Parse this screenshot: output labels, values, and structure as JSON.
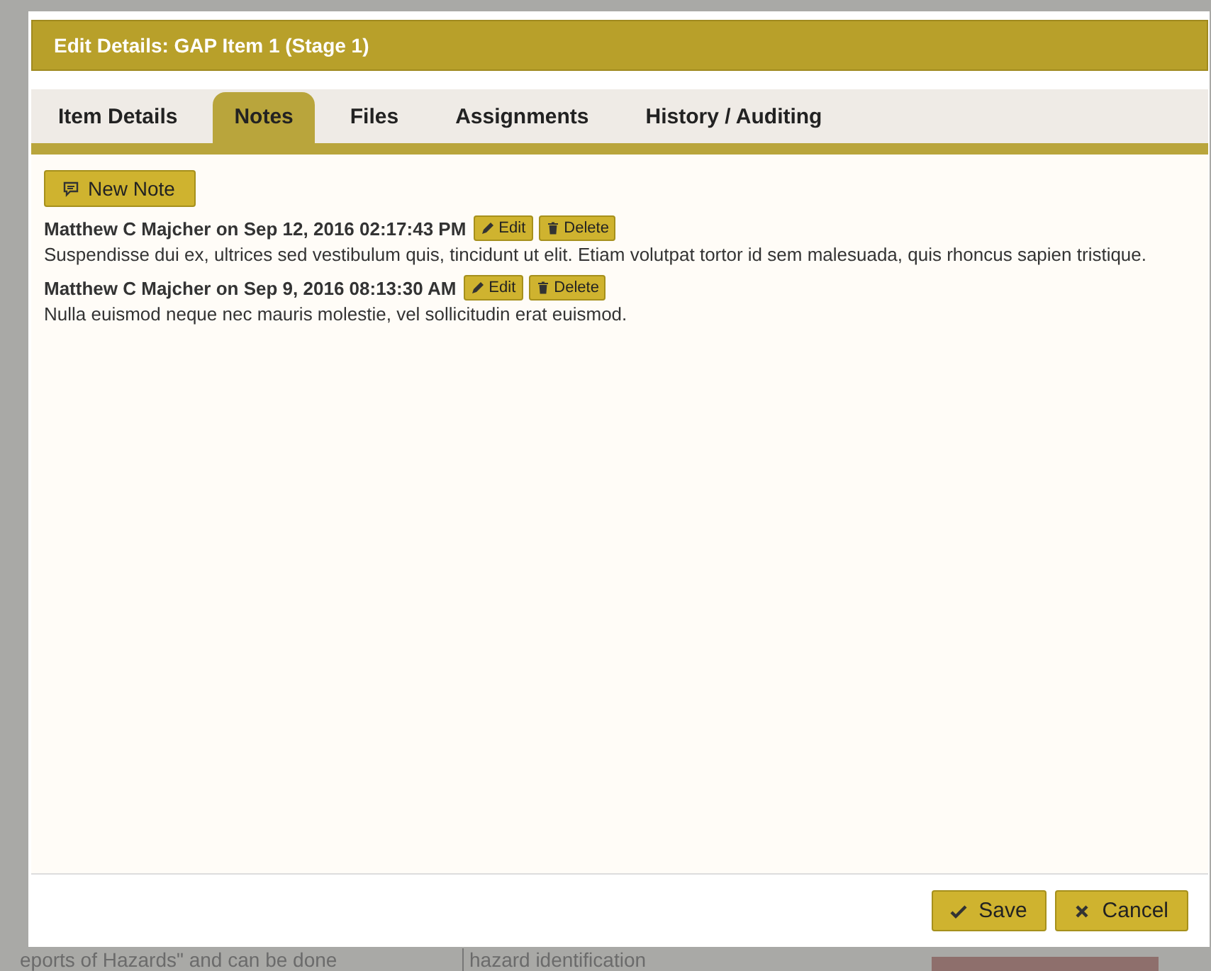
{
  "background": {
    "texts": [
      "eports of Hazards\" and can be done",
      "hazard identification"
    ]
  },
  "dialog": {
    "title": "Edit Details: GAP Item 1 (Stage 1)",
    "tabs": [
      {
        "label": "Item Details",
        "selected": false
      },
      {
        "label": "Notes",
        "selected": true
      },
      {
        "label": "Files",
        "selected": false
      },
      {
        "label": "Assignments",
        "selected": false
      },
      {
        "label": "History / Auditing",
        "selected": false
      }
    ],
    "new_note_button": "New Note",
    "notes": [
      {
        "author_line": "Matthew C Majcher on Sep 12, 2016 02:17:43 PM",
        "edit_button": "Edit",
        "delete_button": "Delete",
        "text": "Suspendisse dui ex, ultrices sed vestibulum quis, tincidunt ut elit. Etiam volutpat tortor id sem malesuada, quis rhoncus sapien tristique."
      },
      {
        "author_line": "Matthew C Majcher on Sep 9, 2016 08:13:30 AM",
        "edit_button": "Edit",
        "delete_button": "Delete",
        "text": "Nulla euismod neque nec mauris molestie, vel sollicitudin erat euismod."
      }
    ],
    "buttons": [
      {
        "kind": "save",
        "label": "Save"
      },
      {
        "kind": "cancel",
        "label": "Cancel"
      }
    ]
  }
}
